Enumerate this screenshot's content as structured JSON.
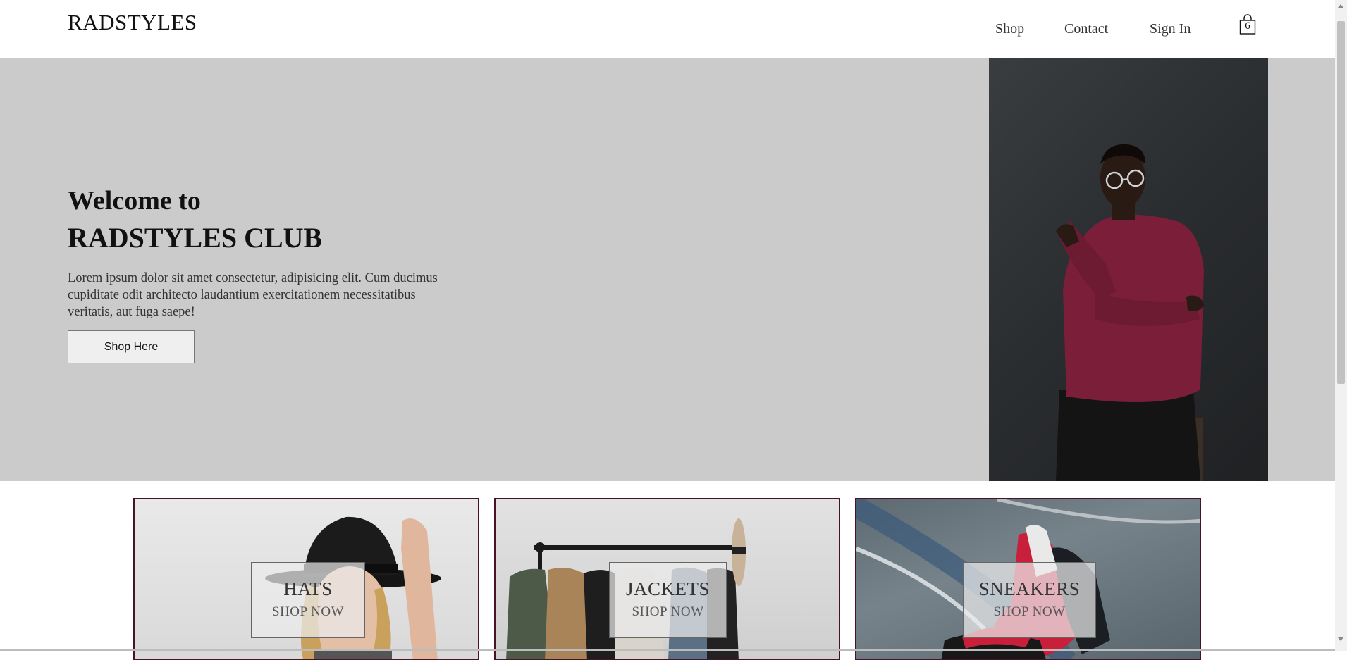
{
  "header": {
    "logo": "RADSTYLES",
    "nav": {
      "shop": "Shop",
      "contact": "Contact",
      "sign_in": "Sign In"
    },
    "bag_count": "6"
  },
  "hero": {
    "welcome": "Welcome to",
    "club": "RADSTYLES CLUB",
    "description": "Lorem ipsum dolor sit amet consectetur, adipisicing elit. Cum ducimus cupiditate odit architecto laudantium exercitationem necessitatibus veritatis, aut fuga saepe!",
    "button": "Shop Here"
  },
  "categories": [
    {
      "title": "HATS",
      "cta": "SHOP NOW"
    },
    {
      "title": "JACKETS",
      "cta": "SHOP NOW"
    },
    {
      "title": "SNEAKERS",
      "cta": "SHOP NOW"
    }
  ],
  "colors": {
    "hero_bg": "#cbcbcb",
    "card_border": "#4a1228",
    "sweater": "#7a1e3a"
  }
}
